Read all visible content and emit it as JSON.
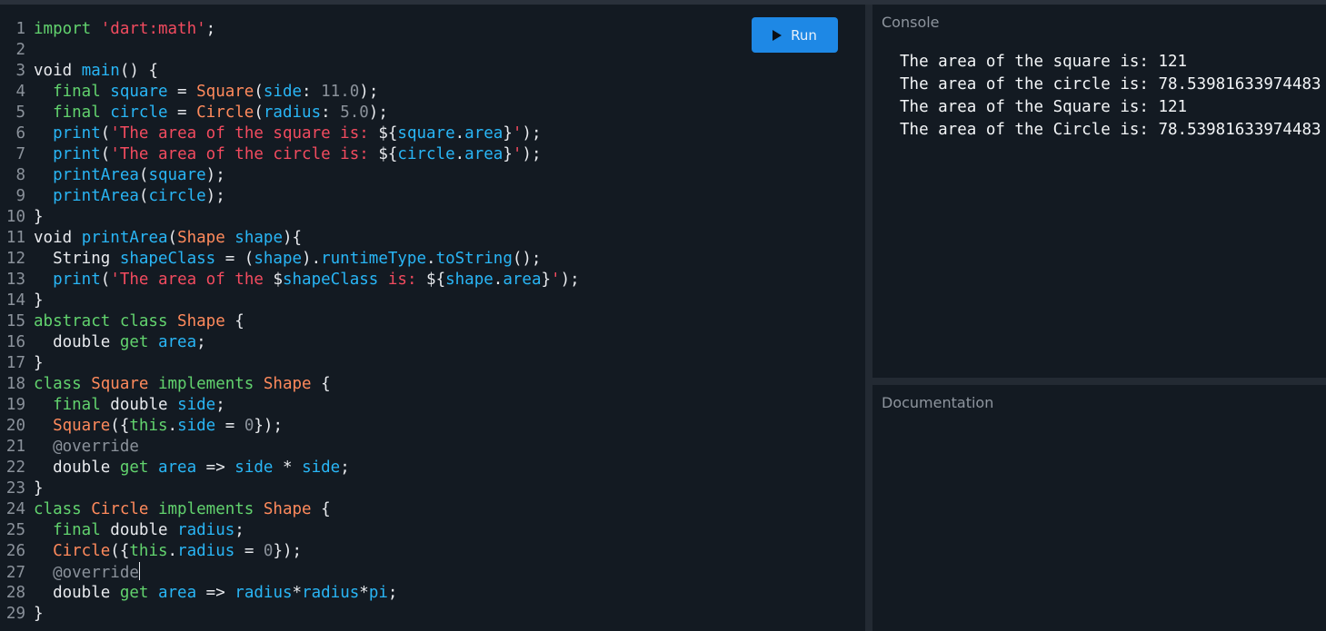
{
  "editor": {
    "run_label": "Run",
    "lines": [
      {
        "n": "1",
        "t": [
          [
            "kw",
            "import "
          ],
          [
            "str",
            "'dart:math'"
          ],
          [
            "tx",
            ";"
          ]
        ]
      },
      {
        "n": "2",
        "t": []
      },
      {
        "n": "3",
        "t": [
          [
            "tx",
            "void "
          ],
          [
            "id",
            "main"
          ],
          [
            "tx",
            "() {"
          ]
        ]
      },
      {
        "n": "4",
        "t": [
          [
            "tx",
            "  "
          ],
          [
            "kw",
            "final "
          ],
          [
            "id",
            "square"
          ],
          [
            "tx",
            " = "
          ],
          [
            "ty",
            "Square"
          ],
          [
            "tx",
            "("
          ],
          [
            "id",
            "side"
          ],
          [
            "tx",
            ": "
          ],
          [
            "num",
            "11.0"
          ],
          [
            "tx",
            ");"
          ]
        ]
      },
      {
        "n": "5",
        "t": [
          [
            "tx",
            "  "
          ],
          [
            "kw",
            "final "
          ],
          [
            "id",
            "circle"
          ],
          [
            "tx",
            " = "
          ],
          [
            "ty",
            "Circle"
          ],
          [
            "tx",
            "("
          ],
          [
            "id",
            "radius"
          ],
          [
            "tx",
            ": "
          ],
          [
            "num",
            "5.0"
          ],
          [
            "tx",
            ");"
          ]
        ]
      },
      {
        "n": "6",
        "t": [
          [
            "tx",
            "  "
          ],
          [
            "id",
            "print"
          ],
          [
            "tx",
            "("
          ],
          [
            "str",
            "'The area of the square is: "
          ],
          [
            "tx",
            "${"
          ],
          [
            "id",
            "square"
          ],
          [
            "tx",
            "."
          ],
          [
            "id",
            "area"
          ],
          [
            "tx",
            "}"
          ],
          [
            "str",
            "'"
          ],
          [
            "tx",
            ");"
          ]
        ]
      },
      {
        "n": "7",
        "t": [
          [
            "tx",
            "  "
          ],
          [
            "id",
            "print"
          ],
          [
            "tx",
            "("
          ],
          [
            "str",
            "'The area of the circle is: "
          ],
          [
            "tx",
            "${"
          ],
          [
            "id",
            "circle"
          ],
          [
            "tx",
            "."
          ],
          [
            "id",
            "area"
          ],
          [
            "tx",
            "}"
          ],
          [
            "str",
            "'"
          ],
          [
            "tx",
            ");"
          ]
        ]
      },
      {
        "n": "8",
        "t": [
          [
            "tx",
            "  "
          ],
          [
            "id",
            "printArea"
          ],
          [
            "tx",
            "("
          ],
          [
            "id",
            "square"
          ],
          [
            "tx",
            ");"
          ]
        ]
      },
      {
        "n": "9",
        "t": [
          [
            "tx",
            "  "
          ],
          [
            "id",
            "printArea"
          ],
          [
            "tx",
            "("
          ],
          [
            "id",
            "circle"
          ],
          [
            "tx",
            ");"
          ]
        ]
      },
      {
        "n": "10",
        "t": [
          [
            "tx",
            "}"
          ]
        ]
      },
      {
        "n": "11",
        "t": [
          [
            "tx",
            "void "
          ],
          [
            "id",
            "printArea"
          ],
          [
            "tx",
            "("
          ],
          [
            "ty",
            "Shape"
          ],
          [
            "tx",
            " "
          ],
          [
            "id",
            "shape"
          ],
          [
            "tx",
            "){"
          ]
        ]
      },
      {
        "n": "12",
        "t": [
          [
            "tx",
            "  String "
          ],
          [
            "id",
            "shapeClass"
          ],
          [
            "tx",
            " = ("
          ],
          [
            "id",
            "shape"
          ],
          [
            "tx",
            ")."
          ],
          [
            "id",
            "runtimeType"
          ],
          [
            "tx",
            "."
          ],
          [
            "id",
            "toString"
          ],
          [
            "tx",
            "();"
          ]
        ]
      },
      {
        "n": "13",
        "t": [
          [
            "tx",
            "  "
          ],
          [
            "id",
            "print"
          ],
          [
            "tx",
            "("
          ],
          [
            "str",
            "'The area of the "
          ],
          [
            "tx",
            "$"
          ],
          [
            "id",
            "shapeClass"
          ],
          [
            "str",
            " is: "
          ],
          [
            "tx",
            "${"
          ],
          [
            "id",
            "shape"
          ],
          [
            "tx",
            "."
          ],
          [
            "id",
            "area"
          ],
          [
            "tx",
            "}"
          ],
          [
            "str",
            "'"
          ],
          [
            "tx",
            ");"
          ]
        ]
      },
      {
        "n": "14",
        "t": [
          [
            "tx",
            "}"
          ]
        ]
      },
      {
        "n": "15",
        "t": [
          [
            "kw",
            "abstract class "
          ],
          [
            "ty",
            "Shape"
          ],
          [
            "tx",
            " {"
          ]
        ]
      },
      {
        "n": "16",
        "t": [
          [
            "tx",
            "  double "
          ],
          [
            "kw",
            "get "
          ],
          [
            "id",
            "area"
          ],
          [
            "tx",
            ";"
          ]
        ]
      },
      {
        "n": "17",
        "t": [
          [
            "tx",
            "}"
          ]
        ]
      },
      {
        "n": "18",
        "t": [
          [
            "kw",
            "class "
          ],
          [
            "ty",
            "Square"
          ],
          [
            "kw",
            " implements "
          ],
          [
            "ty",
            "Shape"
          ],
          [
            "tx",
            " {"
          ]
        ]
      },
      {
        "n": "19",
        "t": [
          [
            "tx",
            "  "
          ],
          [
            "kw",
            "final "
          ],
          [
            "tx",
            "double "
          ],
          [
            "id",
            "side"
          ],
          [
            "tx",
            ";"
          ]
        ]
      },
      {
        "n": "20",
        "t": [
          [
            "tx",
            "  "
          ],
          [
            "ty",
            "Square"
          ],
          [
            "tx",
            "({"
          ],
          [
            "kw",
            "this"
          ],
          [
            "tx",
            "."
          ],
          [
            "id",
            "side"
          ],
          [
            "tx",
            " = "
          ],
          [
            "num",
            "0"
          ],
          [
            "tx",
            "});"
          ]
        ]
      },
      {
        "n": "21",
        "t": [
          [
            "tx",
            "  "
          ],
          [
            "an",
            "@override"
          ]
        ]
      },
      {
        "n": "22",
        "t": [
          [
            "tx",
            "  double "
          ],
          [
            "kw",
            "get "
          ],
          [
            "id",
            "area"
          ],
          [
            "tx",
            " => "
          ],
          [
            "id",
            "side"
          ],
          [
            "tx",
            " * "
          ],
          [
            "id",
            "side"
          ],
          [
            "tx",
            ";"
          ]
        ]
      },
      {
        "n": "23",
        "t": [
          [
            "tx",
            "}"
          ]
        ]
      },
      {
        "n": "24",
        "t": [
          [
            "kw",
            "class "
          ],
          [
            "ty",
            "Circle"
          ],
          [
            "kw",
            " implements "
          ],
          [
            "ty",
            "Shape"
          ],
          [
            "tx",
            " {"
          ]
        ]
      },
      {
        "n": "25",
        "t": [
          [
            "tx",
            "  "
          ],
          [
            "kw",
            "final "
          ],
          [
            "tx",
            "double "
          ],
          [
            "id",
            "radius"
          ],
          [
            "tx",
            ";"
          ]
        ]
      },
      {
        "n": "26",
        "t": [
          [
            "tx",
            "  "
          ],
          [
            "ty",
            "Circle"
          ],
          [
            "tx",
            "({"
          ],
          [
            "kw",
            "this"
          ],
          [
            "tx",
            "."
          ],
          [
            "id",
            "radius"
          ],
          [
            "tx",
            " = "
          ],
          [
            "num",
            "0"
          ],
          [
            "tx",
            "});"
          ]
        ]
      },
      {
        "n": "27",
        "t": [
          [
            "tx",
            "  "
          ],
          [
            "an",
            "@override"
          ],
          [
            "cursor",
            ""
          ]
        ]
      },
      {
        "n": "28",
        "t": [
          [
            "tx",
            "  double "
          ],
          [
            "kw",
            "get "
          ],
          [
            "id",
            "area"
          ],
          [
            "tx",
            " => "
          ],
          [
            "id",
            "radius"
          ],
          [
            "tx",
            "*"
          ],
          [
            "id",
            "radius"
          ],
          [
            "tx",
            "*"
          ],
          [
            "id",
            "pi"
          ],
          [
            "tx",
            ";"
          ]
        ]
      },
      {
        "n": "29",
        "t": [
          [
            "tx",
            "}"
          ]
        ]
      }
    ]
  },
  "console": {
    "title": "Console",
    "output": [
      "The area of the square is: 121",
      "The area of the circle is: 78.53981633974483",
      "The area of the Square is: 121",
      "The area of the Circle is: 78.53981633974483"
    ]
  },
  "documentation": {
    "title": "Documentation"
  },
  "colors": {
    "background": "#131a22",
    "keyword": "#62d36e",
    "type": "#ff8a5c",
    "identifier": "#29b6f6",
    "string": "#f24b5f",
    "run_button": "#1e88e5"
  }
}
